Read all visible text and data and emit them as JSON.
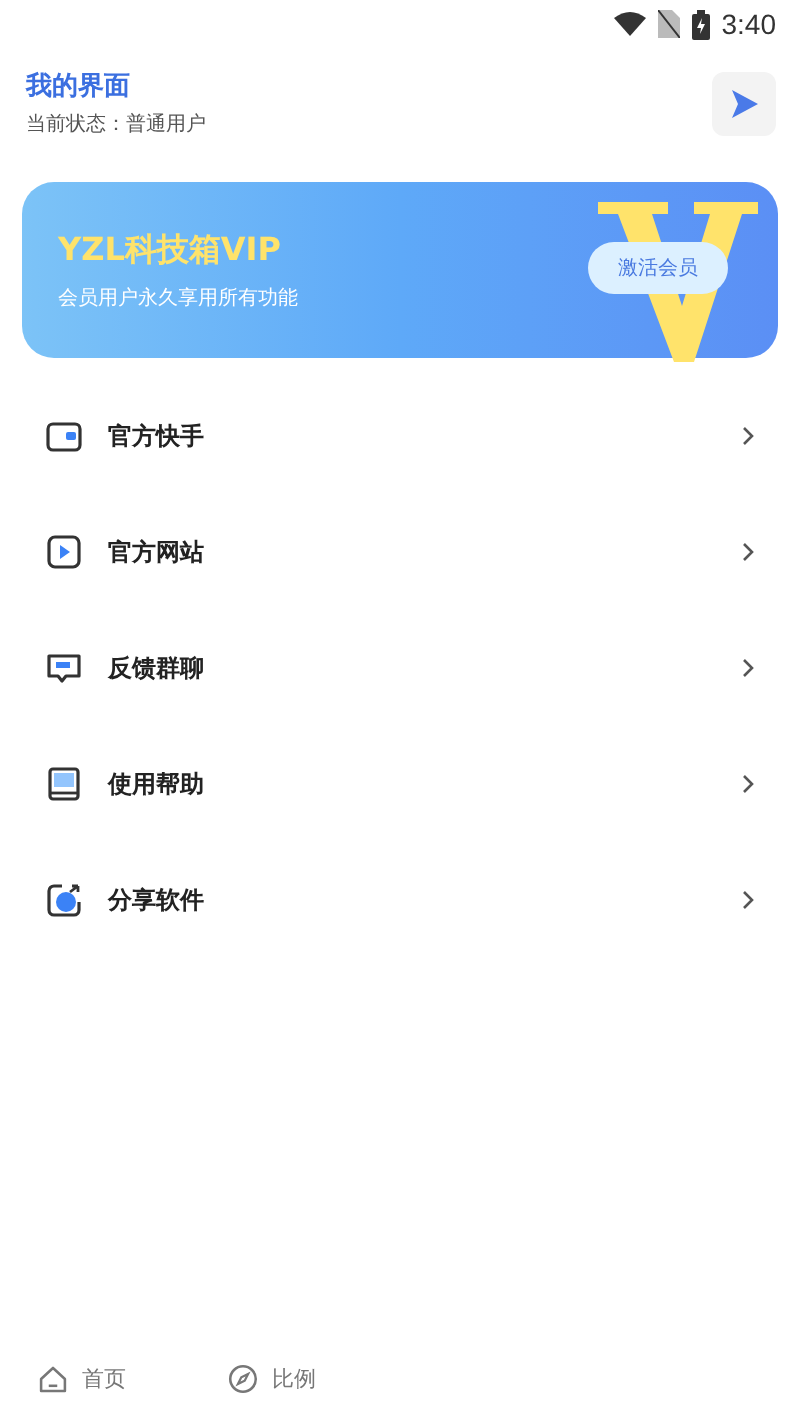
{
  "status_bar": {
    "time": "3:40"
  },
  "header": {
    "title": "我的界面",
    "subtitle": "当前状态：普通用户"
  },
  "banner": {
    "title": "YZL科技箱VIP",
    "subtitle": "会员用户永久享用所有功能",
    "button": "激活会员"
  },
  "menu": [
    {
      "label": "官方快手"
    },
    {
      "label": "官方网站"
    },
    {
      "label": "反馈群聊"
    },
    {
      "label": "使用帮助"
    },
    {
      "label": "分享软件"
    }
  ],
  "bottom_nav": [
    {
      "label": "首页"
    },
    {
      "label": "比例"
    }
  ]
}
